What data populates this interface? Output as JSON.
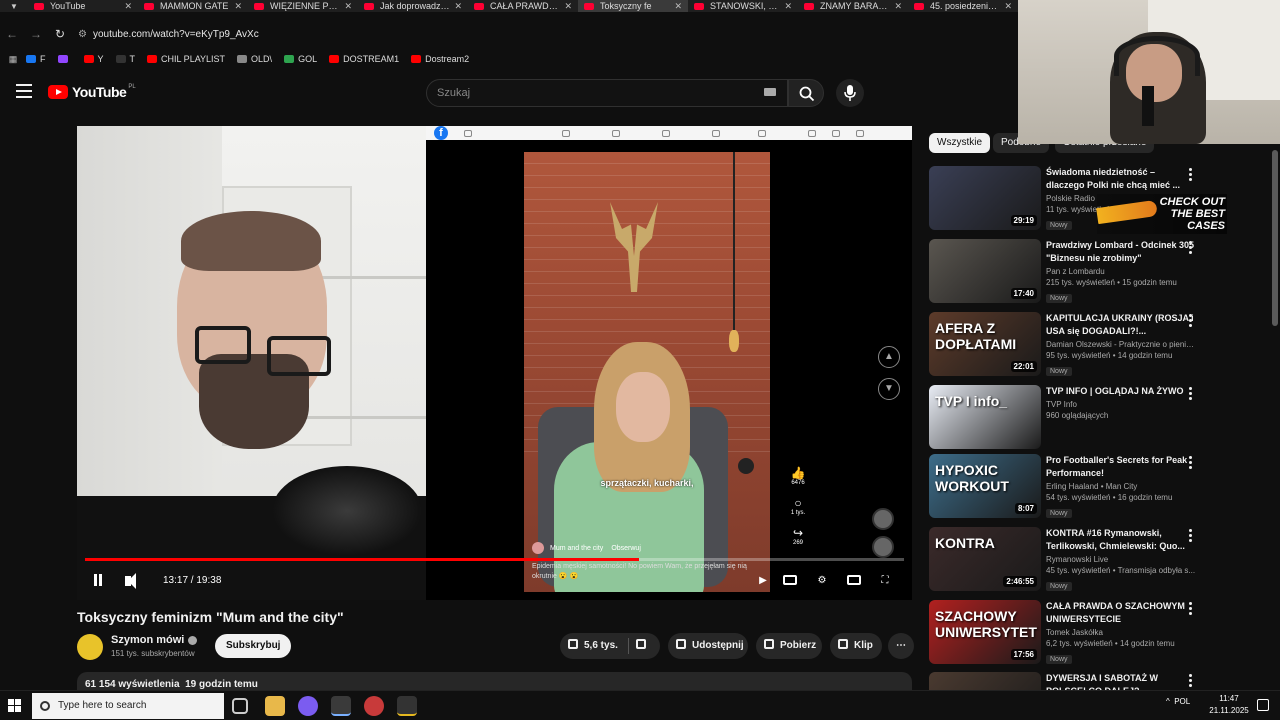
{
  "browser": {
    "tabs": [
      {
        "label": "YouTube",
        "active": false
      },
      {
        "label": "MAMMON GATE",
        "active": false
      },
      {
        "label": "WIĘZIENNE PORA",
        "active": false
      },
      {
        "label": "Jak doprowadzon",
        "active": false
      },
      {
        "label": "CAŁA PRAWDA O",
        "active": false
      },
      {
        "label": "Toksyczny fe",
        "active": true
      },
      {
        "label": "STANOWSKI, ZEM",
        "active": false
      },
      {
        "label": "ZNAMY BARAŻO",
        "active": false
      },
      {
        "label": "45. posiedzenie S",
        "active": false
      }
    ],
    "url": "youtube.com/watch?v=eKyTp9_AvXc",
    "bookmarks": [
      {
        "label": "F",
        "color": "#1877f2"
      },
      {
        "label": "",
        "color": "#9146ff"
      },
      {
        "label": "Y",
        "color": "#ff0000"
      },
      {
        "label": "T",
        "color": "#333333"
      },
      {
        "label": "CHIL PLAYLIST",
        "color": "#ff0000"
      },
      {
        "label": "OLD\\",
        "color": "#888888"
      },
      {
        "label": "GOL",
        "color": "#2ea44f"
      },
      {
        "label": "DOSTREAM1",
        "color": "#ff0000"
      },
      {
        "label": "Dostream2",
        "color": "#ff0000"
      }
    ]
  },
  "header": {
    "logo_text": "YouTube",
    "logo_country": "PL",
    "search_placeholder": "Szukaj"
  },
  "player": {
    "subtitle": "sprzątaczki, kucharki,",
    "reel_author": "Mum and the city",
    "reel_follow": "Obserwuj",
    "reel_desc": "Epidemia męskiej samotności! No powiem Wam, że przejęłam się nią okrutnie 😮 😮",
    "reel_likes": "6476",
    "reel_comments": "1 tys.",
    "reel_shares": "269",
    "time_current": "13:17",
    "time_total": "19:38",
    "progress": 0.676
  },
  "video": {
    "title": "Toksyczny feminizm \"Mum and the city\"",
    "channel": "Szymon mówi",
    "subscribers": "151 tys. subskrybentów",
    "subscribe_label": "Subskrybuj",
    "likes": "5,6 tys.",
    "share_label": "Udostępnij",
    "download_label": "Pobierz",
    "clip_label": "Klip",
    "views": "61 154 wyświetlenia",
    "posted": "19 godzin temu"
  },
  "sidebar": {
    "chips": [
      "Wszystkie",
      "Podobne",
      "Ostatnio przesłane"
    ],
    "recommendations": [
      {
        "title": "Świadoma niedzietność – dlaczego Polki nie chcą mieć ...",
        "channel": "Polskie Radio",
        "meta": "11 tys. wyświetleń",
        "duration": "29:19",
        "badge": "Nowy",
        "thumb": "#3a3f55"
      },
      {
        "title": "Prawdziwy Lombard - Odcinek 305 \"Biznesu nie zrobimy\"",
        "channel": "Pan z Lombardu",
        "meta": "215 tys. wyświetleń • 15 godzin temu",
        "duration": "17:40",
        "badge": "Nowy",
        "thumb": "#5a5650"
      },
      {
        "title": "KAPITULACJA UKRAINY (ROSJA i USA się DOGADALI?!...",
        "channel": "Damian Olszewski - Praktycznie o pienią...",
        "meta": "95 tys. wyświetleń • 14 godzin temu",
        "duration": "22:01",
        "badge": "Nowy",
        "thumb": "#5d3b2a"
      },
      {
        "title": "TVP INFO | OGLĄDAJ NA ŻYWO",
        "channel": "TVP Info",
        "meta": "960 oglądających",
        "duration": "",
        "badge": "",
        "thumb": "#e9edf5"
      },
      {
        "title": "Pro Footballer's Secrets for Peak Performance!",
        "channel": "Erling Haaland • Man City",
        "meta": "54 tys. wyświetleń • 16 godzin temu",
        "duration": "8:07",
        "badge": "Nowy",
        "thumb": "#3d6d8a"
      },
      {
        "title": "KONTRA #16 Rymanowski, Terlikowski, Chmielewski: Quo...",
        "channel": "Rymanowski Live",
        "meta": "45 tys. wyświetleń • Transmisja odbyła s...",
        "duration": "2:46:55",
        "badge": "Nowy",
        "thumb": "#3b2a2a"
      },
      {
        "title": "CAŁA PRAWDA O SZACHOWYM UNIWERSYTECIE",
        "channel": "Tomek Jaskółka",
        "meta": "6,2 tys. wyświetleń • 14 godzin temu",
        "duration": "17:56",
        "badge": "Nowy",
        "thumb": "#b2201f"
      },
      {
        "title": "DYWERSJA I SABOTAŻ W POLSCE! CO DALEJ?",
        "channel": "",
        "meta": "",
        "duration": "",
        "badge": "",
        "thumb": "#4a3a30"
      }
    ],
    "thumb_texts": [
      "",
      "",
      "AFERA Z DOPŁATAMI",
      "TVP I info_",
      "HYPOXIC WORKOUT",
      "KONTRA",
      "SZACHOWY UNIWERSYTET",
      ""
    ]
  },
  "overlay": {
    "ad_text": "CHECK OUT THE BEST CASES"
  },
  "taskbar": {
    "search_placeholder": "Type here to search",
    "lang": "POL",
    "time": "11:47",
    "date": "21.11.2025"
  }
}
